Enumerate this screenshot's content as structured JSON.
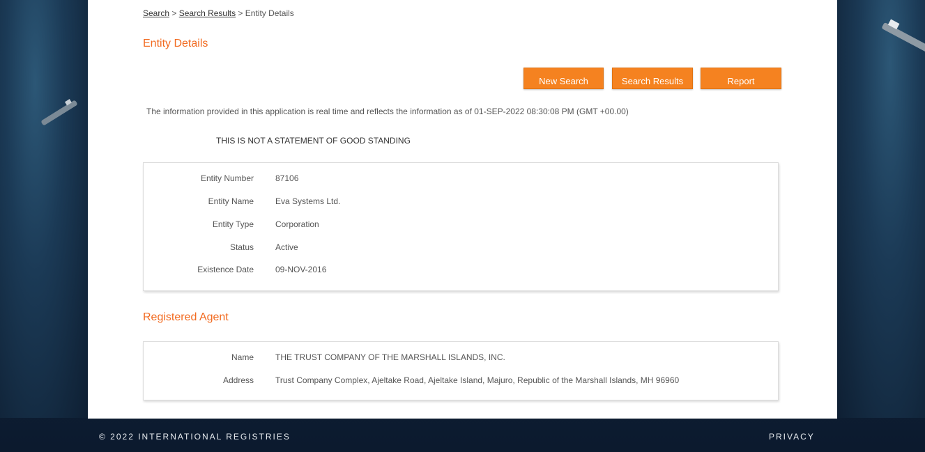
{
  "breadcrumb": {
    "search": "Search",
    "separator1": " > ",
    "search_results": "Search Results",
    "separator2": " > ",
    "current": "Entity Details"
  },
  "entity_section": {
    "title": "Entity Details"
  },
  "buttons": {
    "new_search": "New Search",
    "search_results": "Search Results",
    "report": "Report"
  },
  "info_line": "The information provided in this application is real time and reflects the information as of 01-SEP-2022 08:30:08 PM (GMT +00.00)",
  "notice": "THIS IS NOT A STATEMENT OF GOOD STANDING",
  "entity_details": [
    {
      "label": "Entity Number",
      "value": "87106"
    },
    {
      "label": "Entity Name",
      "value": "Eva Systems Ltd."
    },
    {
      "label": "Entity Type",
      "value": "Corporation"
    },
    {
      "label": "Status",
      "value": "Active"
    },
    {
      "label": "Existence Date",
      "value": "09-NOV-2016"
    }
  ],
  "agent_section": {
    "title": "Registered Agent"
  },
  "agent_details": [
    {
      "label": "Name",
      "value": "THE TRUST COMPANY OF THE MARSHALL ISLANDS, INC."
    },
    {
      "label": "Address",
      "value": "Trust Company Complex, Ajeltake Road, Ajeltake Island, Majuro, Republic of the Marshall Islands, MH 96960"
    }
  ],
  "footer": {
    "copyright": "© 2022 INTERNATIONAL REGISTRIES",
    "privacy": "PRIVACY"
  },
  "colors": {
    "accent": "#f26b21",
    "button": "#f58220",
    "footer_bg": "#0f1f36"
  }
}
